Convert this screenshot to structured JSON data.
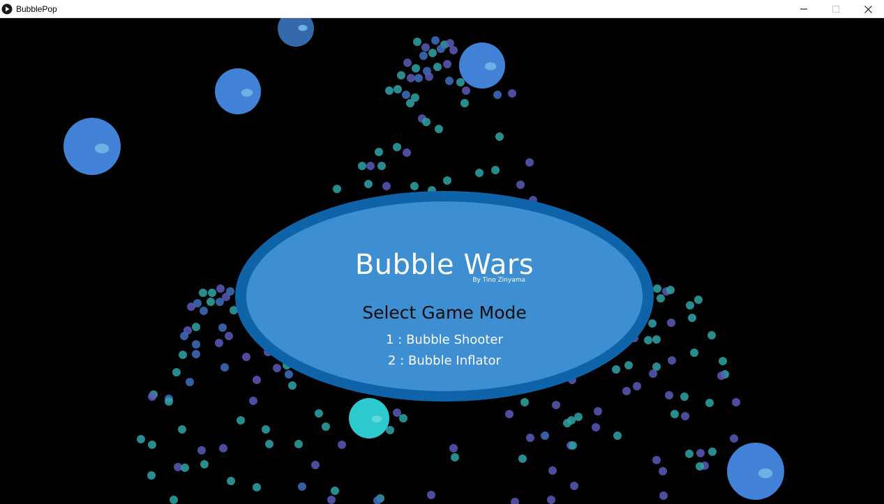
{
  "window": {
    "title": "BubblePop",
    "controls": [
      "minimize-icon",
      "maximize-icon",
      "close-icon"
    ]
  },
  "menu": {
    "title": "Bubble Wars",
    "byline": "By Tino Zinyama",
    "prompt": "Select Game Mode",
    "modes": [
      {
        "label": "1 : Bubble Shooter"
      },
      {
        "label": "2 : Bubble Inflator"
      }
    ]
  },
  "colors": {
    "background": "#000000",
    "panel_fill": "#3d8fd1",
    "panel_border": "#0f63a8",
    "big_bubble": "#4182d6",
    "big_bubble_highlight": "#6cb1e4",
    "cyan_bubble": "#2ec8cf",
    "particle_teal": "#2fa3a6",
    "particle_blue": "#3f6fbf",
    "particle_purple": "#5a5ab8"
  }
}
